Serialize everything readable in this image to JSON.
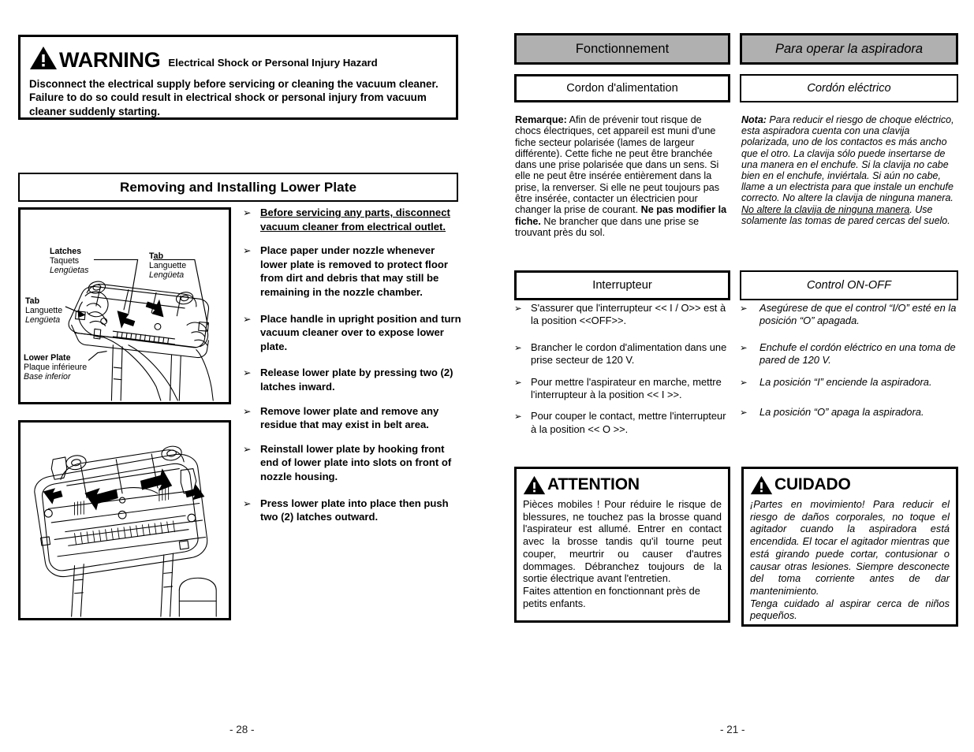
{
  "left_page": {
    "warning": {
      "icon": "warning-triangle-icon",
      "title": "WARNING",
      "subtitle": "Electrical Shock or Personal Injury Hazard",
      "body": "Disconnect the electrical supply before servicing or cleaning the vacuum cleaner. Failure to do so could result in electrical shock or personal injury from vacuum cleaner suddenly starting."
    },
    "section_title": "Removing and Installing Lower Plate",
    "figure_1": {
      "labels": [
        {
          "en": "Latches",
          "fr": "Taquets",
          "es": "Lengüetas"
        },
        {
          "en": "Tab",
          "fr": "Languette",
          "es": "Lengüeta"
        },
        {
          "en": "Tab",
          "fr": "Languette",
          "es": "Lengüeta"
        },
        {
          "en": "Lower Plate",
          "fr": "Plaque inférieure",
          "es": "Base inferior"
        }
      ]
    },
    "bullets": [
      {
        "text": "Before servicing any parts, disconnect vacuum cleaner from electrical outlet.",
        "underline": true
      },
      {
        "text": "Place paper under nozzle whenever lower plate is removed to protect floor from dirt and debris that may still be remaining in the nozzle chamber.",
        "underline": false
      },
      {
        "text": "Place handle in upright position and turn vacuum cleaner over to expose lower plate.",
        "underline": false
      },
      {
        "text": "Release lower plate by pressing two (2) latches inward.",
        "underline": false
      },
      {
        "text": "Remove lower plate and remove any residue that may exist in belt area.",
        "underline": false
      },
      {
        "text": "Reinstall lower plate by hooking front end of lower plate into slots on front of nozzle housing.",
        "underline": false
      },
      {
        "text": "Press lower plate into place then push two (2) latches outward.",
        "underline": false
      }
    ],
    "page_number": "- 28 -"
  },
  "right_page": {
    "french": {
      "header": "Fonctionnement",
      "cord_heading": "Cordon d'alimentation",
      "note_label": "Remarque:",
      "note_body_1": " Afin de prévenir tout risque de chocs électriques, cet appareil est muni d'une fiche secteur polarisée (lames de largeur différente). Cette fiche ne peut être branchée dans une prise polarisée que dans un sens. Si elle ne peut être insérée entièrement dans la prise, la renverser. Si elle ne peut toujours pas être insérée, contacter un électricien pour changer la prise de courant. ",
      "note_bold_2": "Ne pas modifier la fiche.",
      "note_body_3": " Ne brancher que dans une prise se trouvant près du sol.",
      "switch_heading": "Interrupteur",
      "switch_bullets": [
        "S'assurer que l'interrupteur << I / O>> est à la position <<OFF>>.",
        "Brancher le cordon d'alimentation dans une prise secteur de 120 V.",
        "Pour mettre l'aspirateur en marche, mettre l'interrupteur à la position << I >>.",
        "Pour couper le contact, mettre l'interrupteur à la position << O >>."
      ],
      "caution": {
        "icon": "warning-triangle-icon",
        "title": "ATTENTION",
        "body_justified": "Pièces mobiles ! Pour réduire le risque de blessures, ne touchez pas la brosse quand l'aspirateur est allumé. Entrer en contact avec la brosse tandis qu'il tourne peut couper, meurtrir ou causer d'autres dommages. Débranchez toujours de la sortie électrique avant l'entretien.",
        "body_last": "Faites attention en fonctionnant près de petits enfants."
      }
    },
    "spanish": {
      "header": "Para operar la aspiradora",
      "cord_heading": "Cordón eléctrico",
      "note_label": "Nota:",
      "note_body_1": " Para reducir el riesgo de choque eléctrico, esta aspiradora cuenta con una clavija polarizada, uno de los contactos es más ancho que el otro. La clavija sólo puede insertarse de una manera en el enchufe. Si la clavija no cabe bien en el enchufe, inviértala. Si aún no cabe, llame a un electrista para que instale un enchufe correcto. No altere la clavija de ninguna manera. ",
      "note_underline_2": "No altere la clavija de ninguna manera",
      "note_body_3": ". Use solamente las tomas de pared cercas del suelo.",
      "switch_heading": "Control ON-OFF",
      "switch_bullets": [
        "Asegúrese de que el control “I/O” esté en la posición “O” apagada.",
        "Enchufe el cordón eléctrico en una toma de pared de 120 V.",
        "La posición “I”  enciende la aspiradora.",
        "La posición “O”  apaga la aspiradora."
      ],
      "caution": {
        "icon": "warning-triangle-icon",
        "title": "CUIDADO",
        "body_justified": "¡Partes en movimiento! Para reducir el riesgo de daños corporales, no toque el agitador cuando la aspiradora está encendida. El tocar el agitador mientras que está girando puede cortar, contusionar o causar otras lesiones. Siempre desconecte del toma corriente antes de dar mantenimiento.",
        "body_last": "Tenga cuidado al aspirar cerca de niños pequeños."
      }
    },
    "page_number": "- 21 -"
  },
  "bullet_glyph": "➢",
  "colors": {
    "header_gray": "#b0b0b0",
    "ink": "#000000",
    "paper": "#ffffff"
  }
}
